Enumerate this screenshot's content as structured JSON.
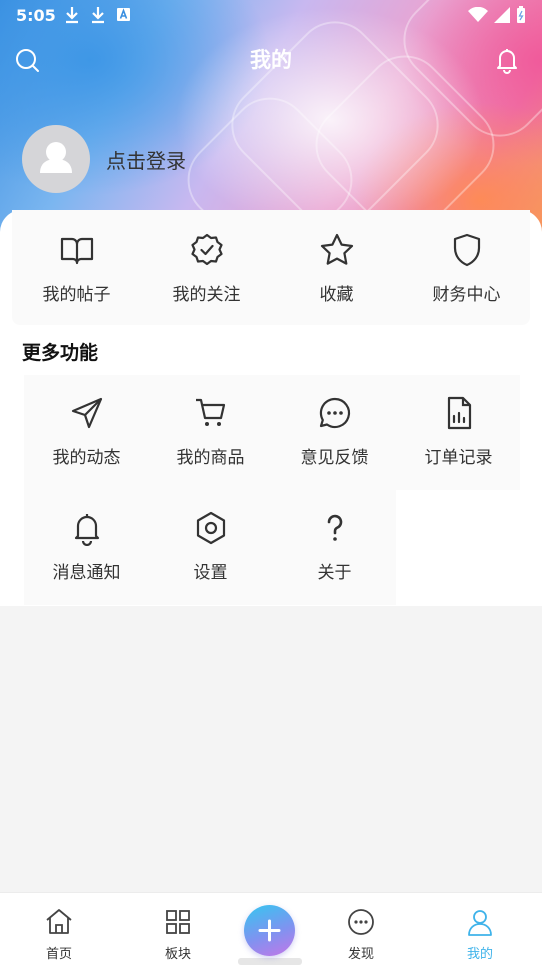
{
  "status": {
    "time": "5:05"
  },
  "header": {
    "title": "我的"
  },
  "profile": {
    "login_text": "点击登录"
  },
  "quick_items": [
    {
      "label": "我的帖子",
      "icon": "book-icon"
    },
    {
      "label": "我的关注",
      "icon": "verified-badge-icon"
    },
    {
      "label": "收藏",
      "icon": "star-icon"
    },
    {
      "label": "财务中心",
      "icon": "shield-icon"
    }
  ],
  "more": {
    "title": "更多功能",
    "items": [
      {
        "label": "我的动态",
        "icon": "send-icon"
      },
      {
        "label": "我的商品",
        "icon": "cart-icon"
      },
      {
        "label": "意见反馈",
        "icon": "chat-bubble-icon"
      },
      {
        "label": "订单记录",
        "icon": "document-chart-icon"
      },
      {
        "label": "消息通知",
        "icon": "bell-icon"
      },
      {
        "label": "设置",
        "icon": "settings-hex-icon"
      },
      {
        "label": "关于",
        "icon": "question-icon"
      }
    ]
  },
  "tabs": [
    {
      "label": "首页",
      "icon": "home-icon"
    },
    {
      "label": "板块",
      "icon": "grid-icon"
    },
    {
      "label": "发现",
      "icon": "discover-chat-icon"
    },
    {
      "label": "我的",
      "icon": "user-icon",
      "active": true
    }
  ],
  "colors": {
    "accent": "#3fb3ea"
  }
}
